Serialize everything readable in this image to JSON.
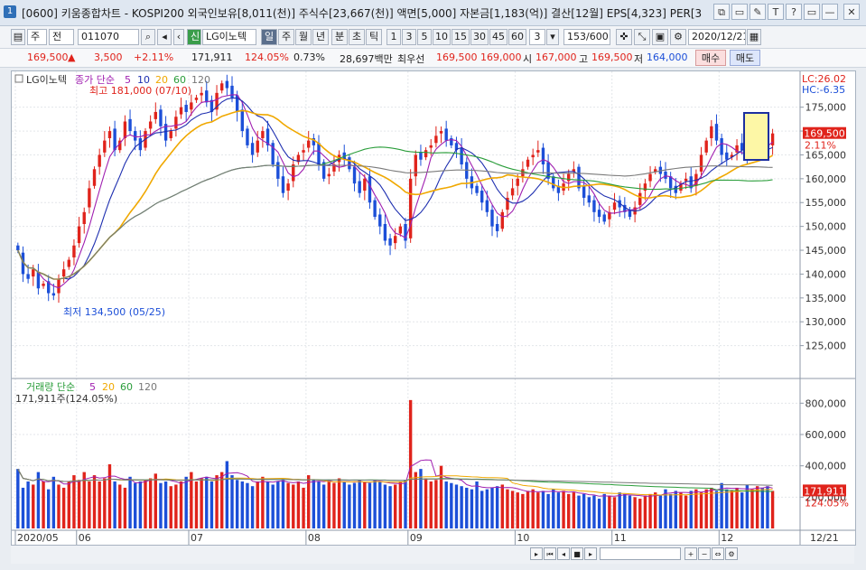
{
  "window": {
    "number": "1",
    "title": "[0600] 키움종합차트 - KOSPI200 외국인보유[8,011(천)] 주식수[23,667(천)] 액면[5,000] 자본금[1,183(억)] 결산[12월] EPS[4,323] PER[3",
    "controls": [
      "⧉",
      "▭",
      "✎",
      "T",
      "?",
      "▭",
      "—",
      "□",
      "✕"
    ]
  },
  "toolbar": {
    "unit_type": "주",
    "unit_mode": "전",
    "code": "011070",
    "stock_badge": "신",
    "stock_name": "LG이노텍",
    "periods": [
      "일",
      "주",
      "월",
      "년",
      "분",
      "초",
      "틱"
    ],
    "active_period": "일",
    "minute_values": [
      "1",
      "3",
      "5",
      "10",
      "15",
      "30",
      "45",
      "60"
    ],
    "selected_unit": "3",
    "count": "153/600",
    "date": "2020/12/21"
  },
  "quote": {
    "price": "169,500",
    "arrow": "▲",
    "change": "3,500",
    "change_pct": "+2.11%",
    "volume": "171,911",
    "volume_ratio": "124.05%",
    "turnover": "0.73%",
    "amount": "28,697백만",
    "best_ask_label": "최우선",
    "best_ask": "169,500",
    "best_bid": "169,000",
    "open_label": "시",
    "open": "167,000",
    "high_label": "고",
    "high": "169,500",
    "low_label": "저",
    "low": "164,000",
    "buy_label": "매수",
    "sell_label": "매도"
  },
  "price_panel": {
    "stock_label": "LG이노텍",
    "legend_prefix": "종가 단순",
    "ma_periods": [
      "5",
      "10",
      "20",
      "60",
      "120"
    ],
    "high_annotation": "최고 181,000 (07/10)",
    "low_annotation": "최저 134,500 (05/25)",
    "lc_label": "LC:26.02",
    "hc_label": "HC:-6.35",
    "current_price_tag": "169,500",
    "current_pct_tag": "2.11%"
  },
  "volume_panel": {
    "legend_prefix": "거래량 단순",
    "ma_periods": [
      "5",
      "20",
      "60",
      "120"
    ],
    "current_volume": "171,911주(124.05%)",
    "current_tag": "171,911",
    "current_pct_tag": "124.05%"
  },
  "x_axis": {
    "labels": [
      "2020/05",
      "06",
      "07",
      "08",
      "09",
      "10",
      "11",
      "12"
    ],
    "right_label": "12/21"
  },
  "colors": {
    "up": "#e0231b",
    "down": "#1c4fd8",
    "ma5": "#a01fb0",
    "ma10": "#1e2fb0",
    "ma20": "#f0a800",
    "ma60": "#2a9d3a",
    "ma120": "#7a7a7a"
  },
  "chart_data": {
    "type": "candlestick",
    "price_axis": {
      "ylim": [
        120000,
        181000
      ],
      "ticks": [
        125000,
        130000,
        135000,
        140000,
        145000,
        150000,
        155000,
        160000,
        165000,
        170000,
        175000
      ]
    },
    "volume_axis": {
      "ylim": [
        0,
        900000
      ],
      "ticks": [
        200000,
        400000,
        600000,
        800000
      ]
    },
    "x": [
      "05/14",
      "05/15",
      "05/18",
      "05/19",
      "05/20",
      "05/21",
      "05/22",
      "05/25",
      "05/26",
      "05/27",
      "05/28",
      "05/29",
      "06/01",
      "06/02",
      "06/03",
      "06/04",
      "06/05",
      "06/08",
      "06/09",
      "06/10",
      "06/11",
      "06/12",
      "06/15",
      "06/16",
      "06/17",
      "06/18",
      "06/19",
      "06/22",
      "06/23",
      "06/24",
      "06/25",
      "06/26",
      "06/29",
      "06/30",
      "07/01",
      "07/02",
      "07/03",
      "07/06",
      "07/07",
      "07/08",
      "07/09",
      "07/10",
      "07/13",
      "07/14",
      "07/15",
      "07/16",
      "07/17",
      "07/20",
      "07/21",
      "07/22",
      "07/23",
      "07/24",
      "07/27",
      "07/28",
      "07/29",
      "07/30",
      "07/31",
      "08/03",
      "08/04",
      "08/05",
      "08/06",
      "08/07",
      "08/10",
      "08/11",
      "08/12",
      "08/13",
      "08/14",
      "08/18",
      "08/19",
      "08/20",
      "08/21",
      "08/24",
      "08/25",
      "08/26",
      "08/27",
      "08/28",
      "08/31",
      "09/01",
      "09/02",
      "09/03",
      "09/04",
      "09/07",
      "09/08",
      "09/09",
      "09/10",
      "09/11",
      "09/14",
      "09/15",
      "09/16",
      "09/17",
      "09/18",
      "09/21",
      "09/22",
      "09/23",
      "09/24",
      "09/25",
      "09/28",
      "09/29",
      "10/05",
      "10/06",
      "10/07",
      "10/08",
      "10/12",
      "10/13",
      "10/14",
      "10/15",
      "10/16",
      "10/19",
      "10/20",
      "10/21",
      "10/22",
      "10/23",
      "10/26",
      "10/27",
      "10/28",
      "10/29",
      "10/30",
      "11/02",
      "11/03",
      "11/04",
      "11/05",
      "11/06",
      "11/09",
      "11/10",
      "11/11",
      "11/12",
      "11/13",
      "11/16",
      "11/17",
      "11/18",
      "11/19",
      "11/20",
      "11/23",
      "11/24",
      "11/25",
      "11/26",
      "11/27",
      "11/30",
      "12/01",
      "12/02",
      "12/03",
      "12/04",
      "12/07",
      "12/08",
      "12/09",
      "12/10",
      "12/11",
      "12/14",
      "12/15",
      "12/16",
      "12/17",
      "12/18",
      "12/21"
    ],
    "close": [
      145000,
      140000,
      139000,
      141000,
      137000,
      138000,
      136000,
      135500,
      139000,
      141000,
      143000,
      146000,
      150000,
      153000,
      158000,
      162000,
      165000,
      168000,
      170000,
      166000,
      168000,
      172000,
      170000,
      168000,
      166000,
      170000,
      172000,
      174000,
      171000,
      168000,
      170000,
      173000,
      175000,
      174000,
      176000,
      177000,
      178000,
      176000,
      174000,
      178000,
      180000,
      179000,
      177000,
      174000,
      170000,
      167000,
      165000,
      168000,
      170000,
      167000,
      163000,
      160000,
      157000,
      159000,
      163000,
      165000,
      166000,
      168000,
      167000,
      163000,
      160000,
      161000,
      163000,
      165000,
      164000,
      162000,
      159000,
      157000,
      160000,
      155000,
      152000,
      150000,
      147000,
      146000,
      148000,
      150000,
      147000,
      160000,
      165000,
      164000,
      166000,
      167000,
      169000,
      170000,
      168000,
      167000,
      166000,
      163000,
      160000,
      158000,
      157000,
      155000,
      153000,
      150000,
      149000,
      153000,
      156000,
      158000,
      160000,
      162000,
      164000,
      165000,
      166000,
      163000,
      160000,
      158000,
      157000,
      159000,
      161000,
      162000,
      158000,
      156000,
      155000,
      153000,
      152000,
      151000,
      153000,
      155000,
      154000,
      153000,
      152000,
      154000,
      157000,
      159000,
      161000,
      162000,
      161000,
      160000,
      158000,
      157000,
      159000,
      160000,
      158000,
      161000,
      165000,
      168000,
      171000,
      168000,
      165000,
      164000,
      165000,
      167000,
      166000,
      165000,
      167000,
      168000,
      168000,
      166000,
      169500
    ],
    "open": [
      146000,
      144500,
      140000,
      139500,
      140500,
      137500,
      138500,
      136000,
      136000,
      139500,
      141500,
      143500,
      146500,
      150500,
      154000,
      158500,
      162500,
      165500,
      168500,
      170500,
      166000,
      168500,
      172500,
      170000,
      168500,
      166500,
      170500,
      172500,
      174500,
      171500,
      168500,
      170500,
      173500,
      175500,
      174500,
      176500,
      177500,
      178500,
      176500,
      174500,
      178500,
      180500,
      179500,
      177500,
      174500,
      170500,
      167500,
      165500,
      168500,
      170500,
      167500,
      163500,
      160500,
      157500,
      159500,
      163500,
      165500,
      166500,
      168500,
      167500,
      163500,
      160500,
      161500,
      163500,
      165500,
      164500,
      162500,
      159500,
      157500,
      160500,
      155500,
      152500,
      150500,
      147500,
      146500,
      148500,
      150500,
      147500,
      160500,
      165500,
      164500,
      166500,
      167500,
      169500,
      170500,
      168500,
      167500,
      166500,
      163500,
      160500,
      158500,
      157500,
      155500,
      153500,
      150500,
      149500,
      153500,
      156500,
      158500,
      160500,
      162500,
      164500,
      165500,
      166500,
      163500,
      160500,
      158500,
      157500,
      159500,
      161500,
      162500,
      158500,
      156500,
      155500,
      153500,
      152500,
      151500,
      153500,
      155500,
      154500,
      153500,
      152500,
      154500,
      157500,
      159500,
      161500,
      162500,
      161500,
      160500,
      158500,
      157500,
      159500,
      160500,
      158500,
      161500,
      165500,
      168500,
      171500,
      168500,
      165500,
      164500,
      165500,
      167500,
      166500,
      165500,
      167500,
      168500,
      168500,
      167000
    ],
    "volume": [
      380000,
      260000,
      300000,
      280000,
      360000,
      300000,
      250000,
      330000,
      280000,
      260000,
      300000,
      340000,
      310000,
      360000,
      300000,
      340000,
      300000,
      320000,
      410000,
      300000,
      280000,
      260000,
      330000,
      290000,
      300000,
      310000,
      320000,
      350000,
      290000,
      300000,
      270000,
      280000,
      300000,
      330000,
      360000,
      300000,
      320000,
      330000,
      300000,
      340000,
      360000,
      430000,
      340000,
      310000,
      300000,
      290000,
      270000,
      300000,
      330000,
      300000,
      280000,
      300000,
      310000,
      290000,
      280000,
      300000,
      260000,
      340000,
      310000,
      300000,
      280000,
      300000,
      290000,
      320000,
      300000,
      280000,
      290000,
      310000,
      300000,
      290000,
      310000,
      300000,
      280000,
      270000,
      280000,
      300000,
      310000,
      820000,
      360000,
      380000,
      320000,
      300000,
      310000,
      400000,
      300000,
      290000,
      280000,
      270000,
      260000,
      250000,
      300000,
      240000,
      250000,
      260000,
      270000,
      280000,
      250000,
      240000,
      230000,
      220000,
      240000,
      250000,
      230000,
      240000,
      220000,
      250000,
      230000,
      240000,
      220000,
      230000,
      210000,
      220000,
      200000,
      210000,
      190000,
      220000,
      210000,
      200000,
      230000,
      220000,
      210000,
      200000,
      190000,
      210000,
      220000,
      230000,
      210000,
      250000,
      220000,
      240000,
      230000,
      210000,
      240000,
      250000,
      230000,
      250000,
      260000,
      240000,
      290000,
      250000,
      240000,
      260000,
      230000,
      280000,
      250000,
      270000,
      260000,
      270000,
      240000
    ],
    "ma_series": [
      "5",
      "10",
      "20",
      "60",
      "120"
    ]
  }
}
